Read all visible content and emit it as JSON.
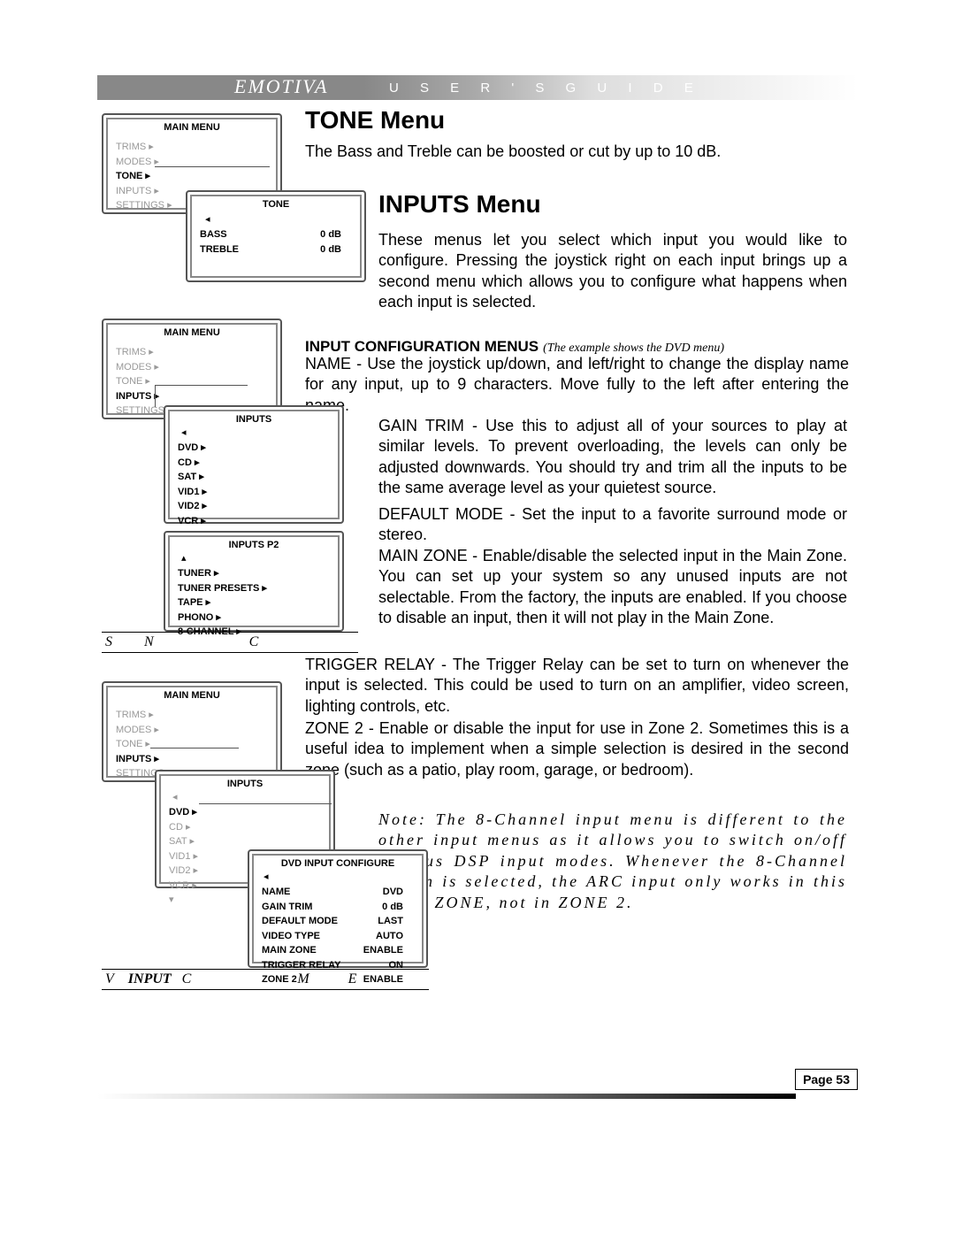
{
  "header": {
    "logo": "EMOTIVA",
    "text": "U S E R ' S   G U I D E"
  },
  "page_number": "Page 53",
  "tone_section": {
    "title": "TONE Menu",
    "body": "The Bass and Treble can be boosted or cut by up to 10 dB."
  },
  "inputs_section": {
    "title": "INPUTS Menu",
    "intro": "These menus let you select which input you would like to configure. Pressing the joystick right on each input brings up a second menu which allows you to configure what happens when each input is selected.",
    "config_title": "INPUT CONFIGURATION MENUS",
    "config_title_note": "(The example shows the DVD menu)",
    "name_para": "NAME - Use the joystick up/down, and left/right to change the display name for any input, up to 9 characters. Move fully to the left after entering the name.",
    "gain_para": "GAIN TRIM - Use this to adjust all of your sources to play at similar levels. To prevent overloading, the levels can only be adjusted downwards. You should try and trim all the inputs to be the same average level as your quietest source.",
    "default_para": "DEFAULT MODE - Set the input to a favorite surround mode or stereo.",
    "main_zone_para": "MAIN ZONE - Enable/disable the selected input in the Main Zone. You can set up your system so any unused inputs are not selectable. From the factory, the inputs are enabled. If you choose to disable an input, then it will not play in the Main Zone.",
    "trigger_para": "TRIGGER RELAY - The Trigger Relay can be set to turn on whenever the input is selected. This could be used to turn on an amplifier, video screen, lighting controls, etc.",
    "zone2_para": "ZONE 2 - Enable or disable the input for use in Zone 2. Sometimes this is a useful idea to implement when a simple selection is desired in the second zone (such as a patio, play room, garage, or bedroom).",
    "note_para": "Note: The 8-Channel input menu is different to the other input menus as it allows you to switch on/off various DSP input modes. Whenever the 8-Channel button is selected, the ARC input only works in this MAIN ZONE, not in ZONE 2."
  },
  "osd": {
    "main_menu_title": "MAIN MENU",
    "trims": "TRIMS",
    "modes": "MODES",
    "tone": "TONE",
    "inputs": "INPUTS",
    "settings": "SETTINGS",
    "tone_title": "TONE",
    "bass": "BASS",
    "treble": "TREBLE",
    "zero_db": "0 dB",
    "inputs_title": "INPUTS",
    "dvd": "DVD",
    "cd": "CD",
    "sat": "SAT",
    "vid1": "VID1",
    "vid2": "VID2",
    "vcr": "VCR",
    "inputs_p2_title": "INPUTS P2",
    "tuner": "TUNER",
    "tuner_presets": "TUNER PRESETS",
    "tape": "TAPE",
    "phono": "PHONO",
    "eight_channel": "8-CHANNEL",
    "dvd_config_title": "DVD INPUT CONFIGURE",
    "name_lbl": "NAME",
    "name_val": "DVD",
    "gain_lbl": "GAIN TRIM",
    "gain_val": "0 dB",
    "default_lbl": "DEFAULT MODE",
    "default_val": "LAST",
    "video_lbl": "VIDEO TYPE",
    "video_val": "AUTO",
    "mainzone_lbl": "MAIN ZONE",
    "mainzone_val": "ENABLE",
    "trigger_lbl": "TRIGGER RELAY",
    "trigger_val": "ON",
    "zone2_lbl": "ZONE 2",
    "zone2_val": "ENABLE"
  },
  "captions": {
    "caption1a": "S",
    "caption1b": "N",
    "caption1c": "C",
    "caption2a": "V",
    "caption2b": "INPUT",
    "caption2c": "C",
    "caption2d": "M",
    "caption2e": "E"
  }
}
